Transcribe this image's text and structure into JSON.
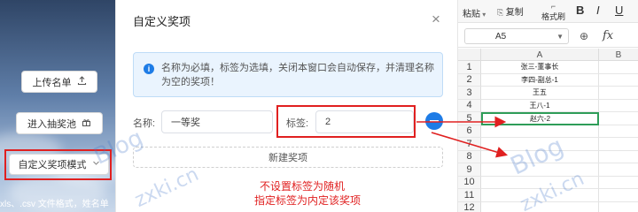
{
  "left_panel": {
    "upload_label": "上传名单",
    "upload_icon": "upload-icon",
    "lottery_label": "进入抽奖池",
    "lottery_icon": "gift-icon",
    "custom_mode_label": "自定义奖项模式",
    "custom_mode_icon": "chevron-down-icon",
    "bottom_note": "xls、.csv 文件格式，姓名单"
  },
  "modal": {
    "title": "自定义奖项",
    "close_glyph": "×",
    "info_icon_glyph": "i",
    "info_text": "名称为必填，标签为选填，关闭本窗口会自动保存，并清理名称为空的奖项！",
    "name_label": "名称:",
    "name_value": "一等奖",
    "tag_label": "标签:",
    "tag_value": "2",
    "new_prize_label": "新建奖项",
    "annotation_line1": "不设置标签为随机",
    "annotation_line2": "指定标签为内定该奖项"
  },
  "spreadsheet": {
    "paste_label": "粘贴",
    "copy_label": "复制",
    "format_painter_label": "格式刷",
    "bold_label": "B",
    "italic_label": "I",
    "underline_label": "U",
    "cell_ref": "A5",
    "fx_label": "fx",
    "columns": [
      "A",
      "B"
    ],
    "rows": [
      {
        "num": "1",
        "value": "张三-董事长"
      },
      {
        "num": "2",
        "value": "李四-副总-1"
      },
      {
        "num": "3",
        "value": "王五"
      },
      {
        "num": "4",
        "value": "王八-1"
      },
      {
        "num": "5",
        "value": "赵六-2"
      },
      {
        "num": "6",
        "value": ""
      },
      {
        "num": "7",
        "value": ""
      },
      {
        "num": "8",
        "value": ""
      },
      {
        "num": "9",
        "value": ""
      },
      {
        "num": "10",
        "value": ""
      },
      {
        "num": "11",
        "value": ""
      },
      {
        "num": "12",
        "value": ""
      }
    ]
  },
  "watermark": {
    "text1": "Blog",
    "text2": "zxki.cn"
  },
  "colors": {
    "accent": "#1e7ce6",
    "annotation": "#e02020",
    "selection": "#2e9d58"
  }
}
